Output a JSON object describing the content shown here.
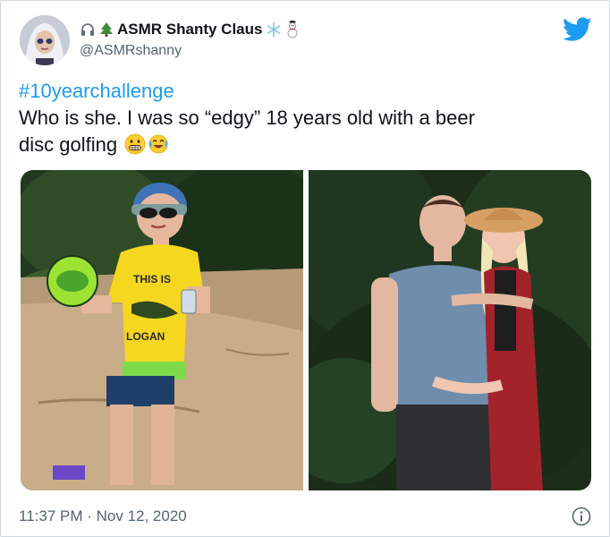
{
  "user": {
    "display_name": "ASMR Shanty Claus",
    "handle": "@ASMRshanny",
    "name_icons": [
      "headphones-icon",
      "christmas-tree-icon",
      "snowflake-icon",
      "snowman-icon"
    ]
  },
  "tweet": {
    "hashtag": "#10yearchallenge",
    "line1": "Who is she. I was so “edgy” 18 years old with a beer",
    "line2": "disc golfing",
    "emojis": [
      "grimacing-face-icon",
      "face-with-tears-of-joy-icon"
    ],
    "timestamp": "11:37 PM · Nov 12, 2020"
  },
  "media": {
    "photo_left": {
      "shirt_text_1": "THIS IS",
      "shirt_text_2": "LOGAN"
    },
    "photo_right": {}
  },
  "icons": {
    "brand": "twitter-bird-icon",
    "info": "info-icon"
  },
  "colors": {
    "accent": "#1d9bf0",
    "text": "#0f1419",
    "secondary": "#536471"
  }
}
